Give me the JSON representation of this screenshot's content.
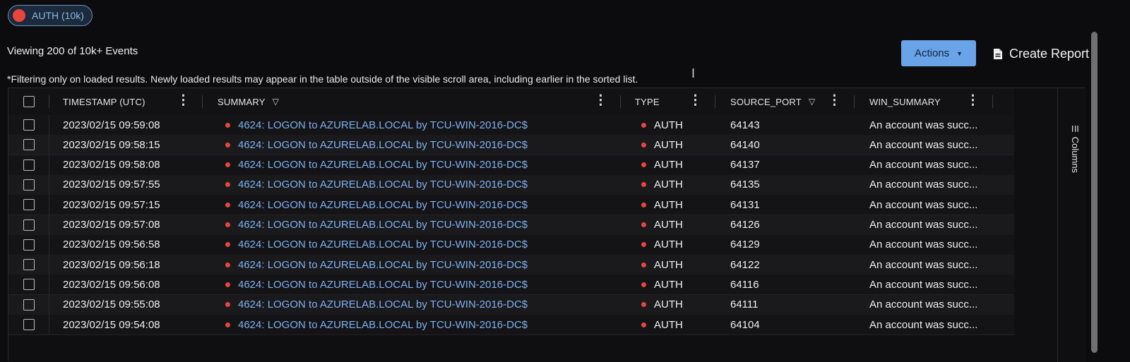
{
  "chip": {
    "label": "AUTH (10k)",
    "dot_color": "#e8453c"
  },
  "viewing_text": "Viewing 200 of 10k+ Events",
  "actions": {
    "label": "Actions",
    "icon": "caret-down-icon"
  },
  "create_report": {
    "label": "Create Report",
    "icon": "document-icon"
  },
  "note": "*Filtering only on loaded results.  Newly loaded results may appear in the table outside of the visible scroll area, including earlier in the sorted list.",
  "columns_panel": {
    "label": "Columns",
    "icon": "columns-icon"
  },
  "headers": {
    "timestamp": "TIMESTAMP (UTC)",
    "summary": "SUMMARY",
    "type": "TYPE",
    "source_port": "SOURCE_PORT",
    "win_summary": "WIN_SUMMARY"
  },
  "rows": [
    {
      "timestamp": "2023/02/15 09:59:08",
      "summary": "4624: LOGON to AZURELAB.LOCAL by TCU-WIN-2016-DC$",
      "type": "AUTH",
      "source_port": "64143",
      "win_summary": "An account was succ..."
    },
    {
      "timestamp": "2023/02/15 09:58:15",
      "summary": "4624: LOGON to AZURELAB.LOCAL by TCU-WIN-2016-DC$",
      "type": "AUTH",
      "source_port": "64140",
      "win_summary": "An account was succ..."
    },
    {
      "timestamp": "2023/02/15 09:58:08",
      "summary": "4624: LOGON to AZURELAB.LOCAL by TCU-WIN-2016-DC$",
      "type": "AUTH",
      "source_port": "64137",
      "win_summary": "An account was succ..."
    },
    {
      "timestamp": "2023/02/15 09:57:55",
      "summary": "4624: LOGON to AZURELAB.LOCAL by TCU-WIN-2016-DC$",
      "type": "AUTH",
      "source_port": "64135",
      "win_summary": "An account was succ..."
    },
    {
      "timestamp": "2023/02/15 09:57:15",
      "summary": "4624: LOGON to AZURELAB.LOCAL by TCU-WIN-2016-DC$",
      "type": "AUTH",
      "source_port": "64131",
      "win_summary": "An account was succ..."
    },
    {
      "timestamp": "2023/02/15 09:57:08",
      "summary": "4624: LOGON to AZURELAB.LOCAL by TCU-WIN-2016-DC$",
      "type": "AUTH",
      "source_port": "64126",
      "win_summary": "An account was succ..."
    },
    {
      "timestamp": "2023/02/15 09:56:58",
      "summary": "4624: LOGON to AZURELAB.LOCAL by TCU-WIN-2016-DC$",
      "type": "AUTH",
      "source_port": "64129",
      "win_summary": "An account was succ..."
    },
    {
      "timestamp": "2023/02/15 09:56:18",
      "summary": "4624: LOGON to AZURELAB.LOCAL by TCU-WIN-2016-DC$",
      "type": "AUTH",
      "source_port": "64122",
      "win_summary": "An account was succ..."
    },
    {
      "timestamp": "2023/02/15 09:56:08",
      "summary": "4624: LOGON to AZURELAB.LOCAL by TCU-WIN-2016-DC$",
      "type": "AUTH",
      "source_port": "64116",
      "win_summary": "An account was succ..."
    },
    {
      "timestamp": "2023/02/15 09:55:08",
      "summary": "4624: LOGON to AZURELAB.LOCAL by TCU-WIN-2016-DC$",
      "type": "AUTH",
      "source_port": "64111",
      "win_summary": "An account was succ..."
    },
    {
      "timestamp": "2023/02/15 09:54:08",
      "summary": "4624: LOGON to AZURELAB.LOCAL by TCU-WIN-2016-DC$",
      "type": "AUTH",
      "source_port": "64104",
      "win_summary": "An account was succ..."
    }
  ],
  "colors": {
    "accent": "#69a4e8",
    "link": "#7fb0f0",
    "status_dot": "#e8453c"
  }
}
